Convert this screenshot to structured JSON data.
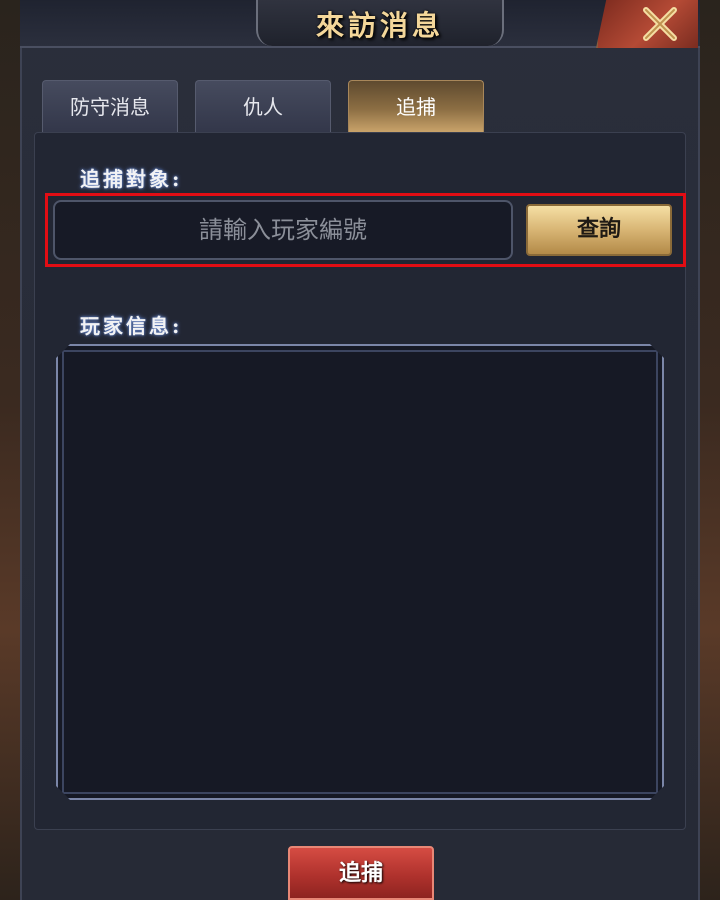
{
  "header": {
    "title": "來訪消息"
  },
  "tabs": [
    {
      "label": "防守消息",
      "active": false
    },
    {
      "label": "仇人",
      "active": false
    },
    {
      "label": "追捕",
      "active": true
    }
  ],
  "search": {
    "label": "追捕對象:",
    "placeholder": "請輸入玩家編號",
    "value": "",
    "button_label": "查詢"
  },
  "player_info": {
    "label": "玩家信息:"
  },
  "footer": {
    "arrest_button_label": "追捕"
  },
  "colors": {
    "accent_gold": "#d8b574",
    "highlight_red": "#e20d14",
    "arrest_red": "#b0322d",
    "title_gold": "#f4d79a"
  },
  "icons": {
    "close": "close-x-icon"
  }
}
